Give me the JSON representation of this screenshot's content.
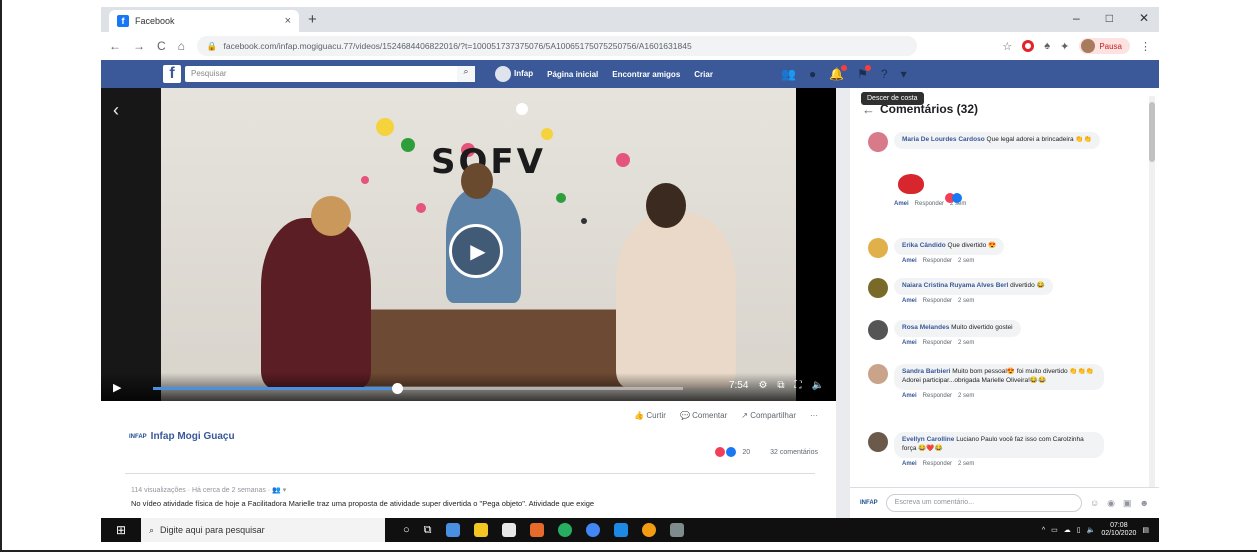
{
  "browser": {
    "tab_title": "Facebook",
    "tab_close": "×",
    "new_tab": "+",
    "url": "facebook.com/infap.mogiguacu.77/videos/1524684406822016/?t=100051737375076/5A10065175075250756/A1601631845",
    "window_controls": [
      "–",
      "□",
      "✕"
    ],
    "profile_pill": "Pausa"
  },
  "fbnav": {
    "logo": "f",
    "search_placeholder": "Pesquisar",
    "profile_name": "Infap",
    "links": [
      "Página inicial",
      "Encontrar amigos",
      "Criar"
    ]
  },
  "video": {
    "sign_text": "SOFV",
    "time": "7:54",
    "progress": 0.46
  },
  "post": {
    "actions": [
      "Curtir",
      "Comentar",
      "Compartilhar"
    ],
    "more": "···",
    "page_logo": "INFAP",
    "page_name": "Infap Mogi Guaçu",
    "reaction_count": "20",
    "comments_count": "32 comentários",
    "meta": "114 visualizações · Há cerca de 2 semanas · 👥 ▾",
    "description": "No vídeo atividade física de hoje a Facilitadora Marielle traz uma proposta de atividade super divertida o \"Pega objeto\". Atividade que exige"
  },
  "comments": {
    "tooltip": "Descer de costa",
    "title": "Comentários (32)",
    "like_label": "Amei",
    "reply_label": "Responder",
    "items": [
      {
        "author": "Maria De Lourdes Cardoso",
        "text": "Que legal adorei a brincadeira 👏👏",
        "time": "2 sem"
      },
      {
        "author": "",
        "text": "",
        "time": "2 sem"
      },
      {
        "author": "Erika Cândido",
        "text": "Que divertido 😍",
        "time": "2 sem"
      },
      {
        "author": "Naiara Cristina Ruyama Alves Berl",
        "text": "divertido 😂",
        "time": "2 sem"
      },
      {
        "author": "Rosa Melandes",
        "text": "Muito divertido gostei",
        "time": "2 sem"
      },
      {
        "author": "Sandra Barbieri",
        "text": "Muito bom pessoal😍 foi muito divertido 👏👏👏 Adorei participar...obrigada Marielle Oliveira!😂😂",
        "time": "2 sem"
      },
      {
        "author": "Evellyn Carolline",
        "text": "Luciano Paulo você faz isso com Carolzinha força 😂❤️😂",
        "time": "2 sem"
      }
    ],
    "input_placeholder": "Escreva um comentário...",
    "input_page_logo": "INFAP"
  },
  "taskbar": {
    "search_placeholder": "Digite aqui para pesquisar",
    "time": "07:08",
    "date": "02/10/2020"
  }
}
